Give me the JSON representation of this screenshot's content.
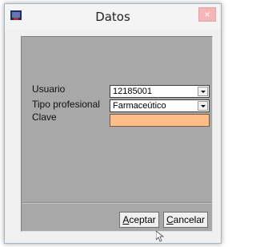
{
  "window": {
    "title": "Datos",
    "close_glyph": "×"
  },
  "form": {
    "usuario": {
      "label": "Usuario",
      "value": "12185001"
    },
    "tipo_profesional": {
      "label": "Tipo profesional",
      "value": "Farmaceútico"
    },
    "clave": {
      "label": "Clave",
      "value": ""
    }
  },
  "buttons": {
    "accept": {
      "underline": "A",
      "rest": "ceptar"
    },
    "cancel": {
      "underline": "C",
      "rest": "ancelar"
    }
  },
  "colors": {
    "panel": "#a8a8a8",
    "password_field": "#ffbd87",
    "close_button": "#f4b6b6"
  }
}
